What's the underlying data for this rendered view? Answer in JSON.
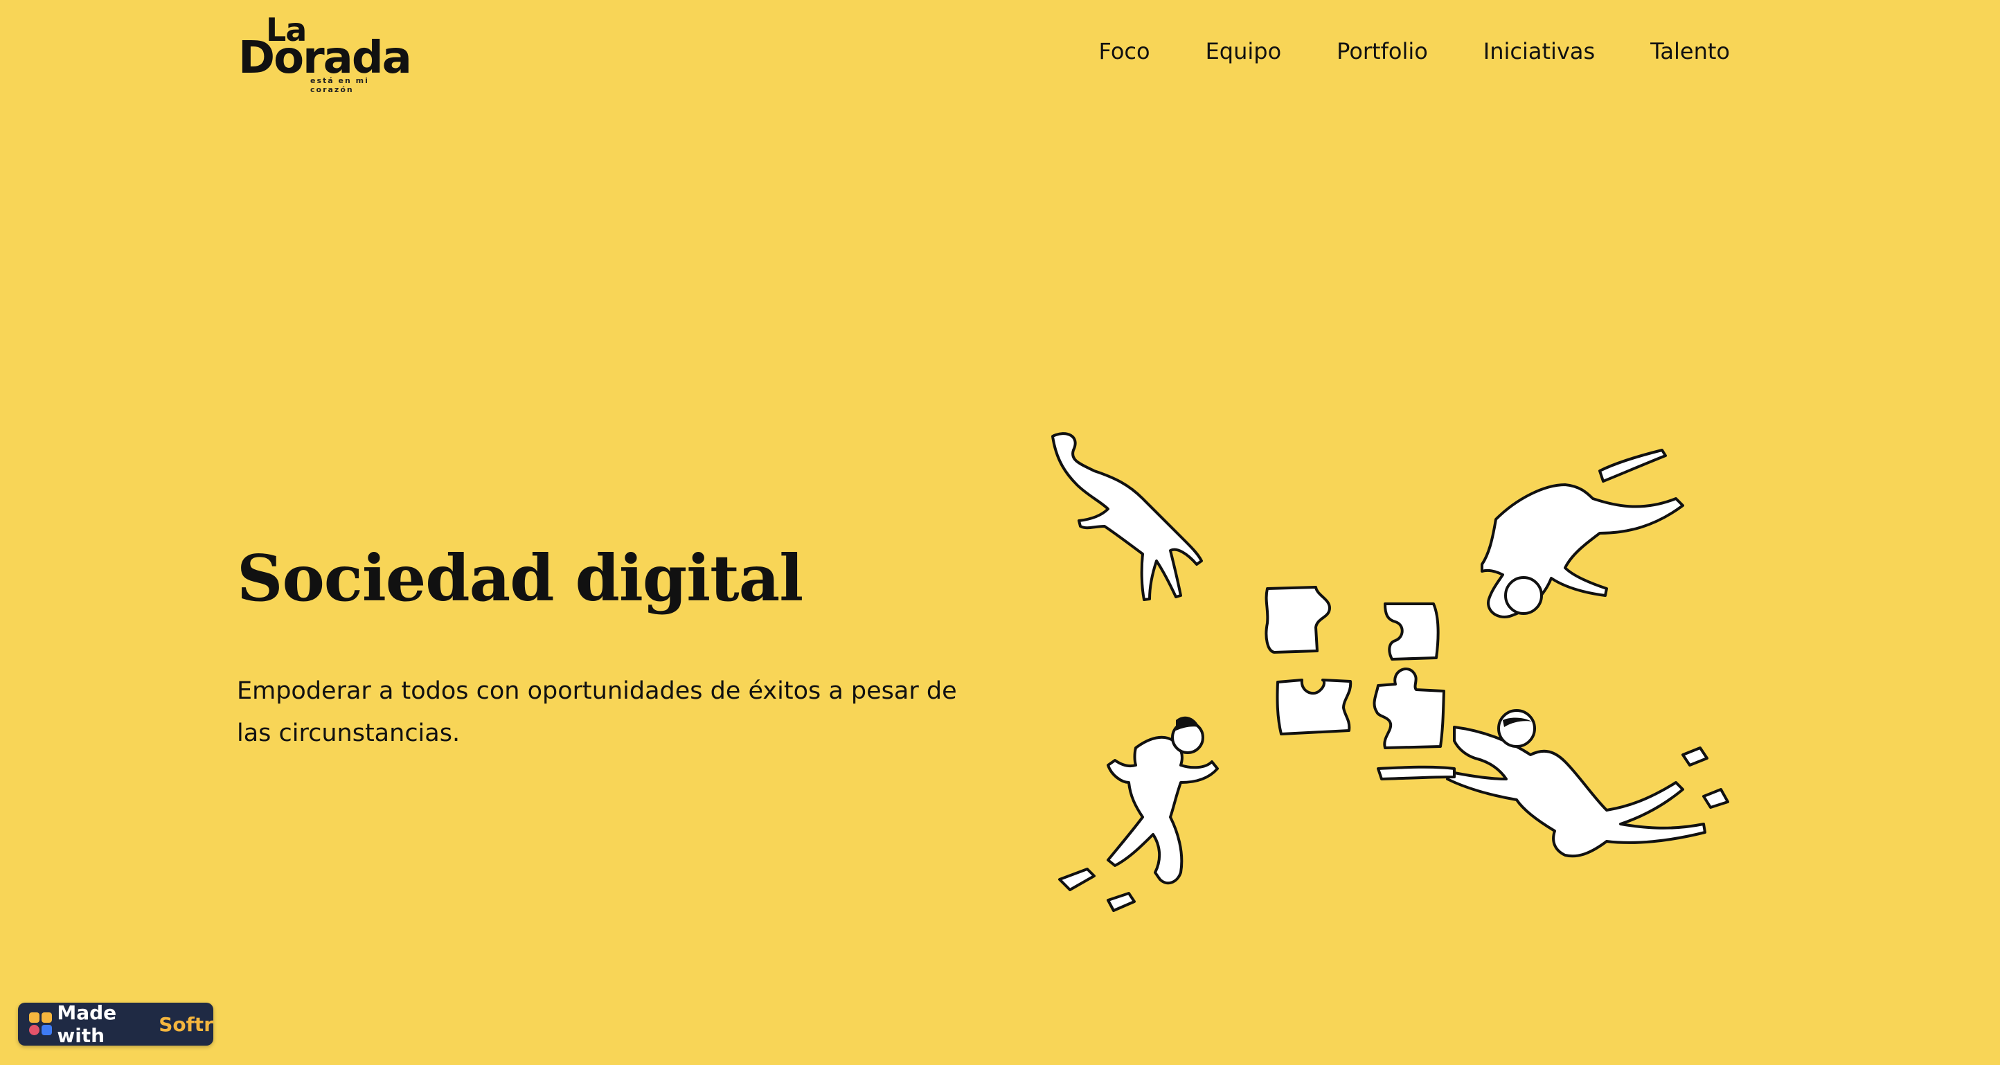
{
  "brand": {
    "logo_top": "La",
    "logo_word": "Dorada",
    "logo_tagline": "está en mi corazón"
  },
  "nav": {
    "items": [
      {
        "label": "Foco"
      },
      {
        "label": "Equipo"
      },
      {
        "label": "Portfolio"
      },
      {
        "label": "Iniciativas"
      },
      {
        "label": "Talento"
      }
    ]
  },
  "hero": {
    "title": "Sociedad digital",
    "description": "Empoderar a todos con oportunidades de éxitos a pesar de las circunstancias.",
    "illustration_icon": "puzzle-team-illustration"
  },
  "badge": {
    "prefix": "Made with",
    "brand": "Softr",
    "icon": "softr-logo-icon"
  },
  "colors": {
    "background": "#F8D557",
    "text": "#111111",
    "badge_bg": "#1F2A44",
    "badge_brand": "#F5B63E"
  }
}
